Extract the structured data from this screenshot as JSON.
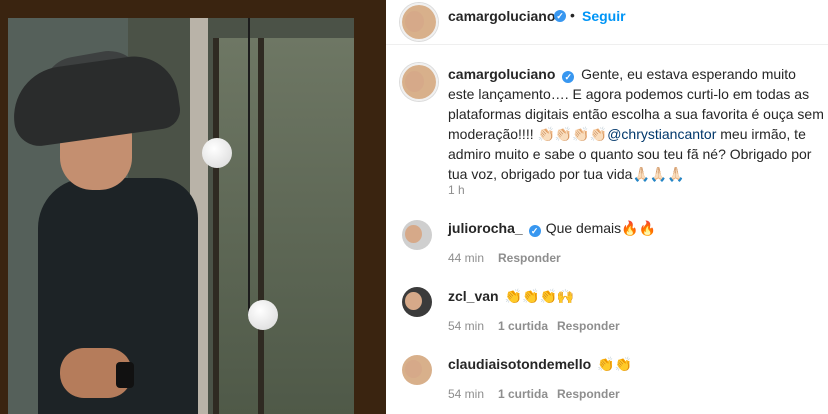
{
  "post": {
    "header": {
      "username": "camargoluciano",
      "verified_mark": "✓",
      "separator": "•",
      "follow_label": "Seguir"
    },
    "caption": {
      "username": "camargoluciano",
      "text_1": "Gente, eu estava esperando muito este lançamento…. E agora podemos curti-lo em todas as plataformas digitais então escolha a sua favorita é ouça sem moderação!!!! 👏🏻👏🏻👏🏻👏🏻",
      "mention": "@chrystiancantor",
      "text_2": " meu irmão, te admiro muito e sabe o quanto sou teu fã né? Obrigado por tua voz, obrigado por tua vida🙏🏻🙏🏻🙏🏻",
      "time": "1 h"
    },
    "comments": [
      {
        "username": "juliorocha_",
        "verified": true,
        "text": "Que demais🔥🔥",
        "time": "44 min",
        "likes": "",
        "reply": "Responder"
      },
      {
        "username": "zcl_van",
        "verified": false,
        "text": "👏👏👏🙌",
        "time": "54 min",
        "likes": "1 curtida",
        "reply": "Responder"
      },
      {
        "username": "claudiaisotondemello",
        "verified": false,
        "text": "👏👏",
        "time": "54 min",
        "likes": "1 curtida",
        "reply": "Responder"
      }
    ]
  },
  "colors": {
    "link_blue": "#0095f6",
    "verified_blue": "#3897f0",
    "mention": "#00376b",
    "meta_gray": "#8e8e8e"
  }
}
